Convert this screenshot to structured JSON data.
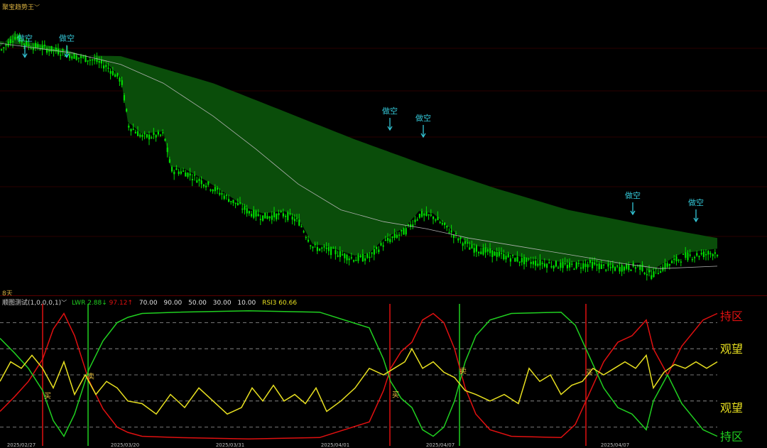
{
  "header": {
    "indicator_name": "聚宝趋势王",
    "dropdown_icon": "chevron-down-icon"
  },
  "lower_header": {
    "indicator_name": "顺图测试(1,0,0,0,1)",
    "lwr_label": "LWR",
    "lwr_value": "2.88",
    "lwr_arrow": "↓",
    "lwr_value2": "97.12",
    "lwr_arrow2": "↑",
    "levels": [
      "70.00",
      "90.00",
      "50.00",
      "30.00",
      "10.00"
    ],
    "rsi_label": "RSI3",
    "rsi_value": "60.66"
  },
  "divider_label": "8天",
  "colors": {
    "background": "#000000",
    "up_candle": "#00e000",
    "band_fill": "#0a4d0a",
    "ma_line": "#b0b0b0",
    "signal_text": "#33c6d6",
    "buy_text": "#e8c040",
    "red_line": "#e01010",
    "green_line": "#20d020",
    "yellow_line": "#e8e020",
    "hold_label": "#e01010",
    "watch_label": "#e8e020",
    "hold2_label": "#20d020",
    "dashed": "#9a9a9a",
    "frame": "#5a0000"
  },
  "chart_data": [
    {
      "type": "candlestick",
      "title": "聚宝趋势王",
      "x_dates": [
        "2025/02/27",
        "2025/03/20",
        "2025/03/31",
        "2025/04/01",
        "2025/04/07",
        "2025/04/07"
      ],
      "price_path": [
        [
          0,
          30
        ],
        [
          20,
          30.6
        ],
        [
          40,
          30.2
        ],
        [
          60,
          30.1
        ],
        [
          90,
          29.9
        ],
        [
          110,
          29.7
        ],
        [
          130,
          29.6
        ],
        [
          150,
          29.3
        ],
        [
          170,
          28.7
        ],
        [
          180,
          26.8
        ],
        [
          200,
          26.3
        ],
        [
          230,
          26.4
        ],
        [
          240,
          24.9
        ],
        [
          260,
          24.8
        ],
        [
          290,
          24.3
        ],
        [
          320,
          23.7
        ],
        [
          350,
          23.1
        ],
        [
          370,
          22.9
        ],
        [
          400,
          23.0
        ],
        [
          420,
          22.7
        ],
        [
          440,
          21.6
        ],
        [
          460,
          21.5
        ],
        [
          500,
          21.1
        ],
        [
          520,
          21.2
        ],
        [
          540,
          21.8
        ],
        [
          570,
          22.3
        ],
        [
          590,
          23.0
        ],
        [
          610,
          22.9
        ],
        [
          640,
          22.1
        ],
        [
          660,
          21.6
        ],
        [
          700,
          21.3
        ],
        [
          740,
          21.0
        ],
        [
          770,
          20.9
        ],
        [
          800,
          20.8
        ],
        [
          830,
          20.9
        ],
        [
          860,
          20.7
        ],
        [
          900,
          20.8
        ],
        [
          915,
          20.4
        ],
        [
          930,
          20.7
        ],
        [
          960,
          21.2
        ],
        [
          1010,
          21.4
        ]
      ],
      "ma_path": [
        [
          0,
          30.3
        ],
        [
          100,
          29.9
        ],
        [
          170,
          29.4
        ],
        [
          230,
          28.6
        ],
        [
          300,
          27.2
        ],
        [
          360,
          25.8
        ],
        [
          420,
          24.3
        ],
        [
          480,
          23.2
        ],
        [
          540,
          22.7
        ],
        [
          600,
          22.4
        ],
        [
          660,
          22.0
        ],
        [
          720,
          21.7
        ],
        [
          800,
          21.3
        ],
        [
          880,
          20.9
        ],
        [
          930,
          20.7
        ],
        [
          1010,
          20.8
        ]
      ],
      "band_top_path": [
        [
          0,
          30.4
        ],
        [
          100,
          29.8
        ],
        [
          170,
          29.75
        ],
        [
          300,
          28.6
        ],
        [
          400,
          27.4
        ],
        [
          500,
          26.2
        ],
        [
          600,
          25.1
        ],
        [
          700,
          24.1
        ],
        [
          800,
          23.2
        ],
        [
          900,
          22.6
        ],
        [
          1010,
          22.0
        ]
      ],
      "ylim": [
        19.8,
        31.6
      ],
      "signals": [
        {
          "x": 35,
          "y": 30.1,
          "label": "做空"
        },
        {
          "x": 94,
          "y": 30.1,
          "label": "做空"
        },
        {
          "x": 549,
          "y": 27.0,
          "label": "做空"
        },
        {
          "x": 596,
          "y": 26.7,
          "label": "做空"
        },
        {
          "x": 891,
          "y": 23.4,
          "label": "做空"
        },
        {
          "x": 980,
          "y": 23.1,
          "label": "做空"
        }
      ]
    },
    {
      "type": "line",
      "title": "顺图测试(1,0,0,0,1)",
      "ylim": [
        0,
        100
      ],
      "levels": [
        90,
        70,
        50,
        30,
        10
      ],
      "series": [
        {
          "name": "LWR",
          "color": "#e01010",
          "points": [
            [
              0,
              22
            ],
            [
              20,
              33
            ],
            [
              40,
              45
            ],
            [
              60,
              62
            ],
            [
              75,
              85
            ],
            [
              90,
              97
            ],
            [
              105,
              80
            ],
            [
              125,
              46
            ],
            [
              145,
              24
            ],
            [
              165,
              10
            ],
            [
              180,
              6
            ],
            [
              200,
              3
            ],
            [
              250,
              2
            ],
            [
              350,
              1
            ],
            [
              450,
              2
            ],
            [
              520,
              14
            ],
            [
              540,
              38
            ],
            [
              550,
              55
            ],
            [
              565,
              68
            ],
            [
              580,
              75
            ],
            [
              595,
              92
            ],
            [
              610,
              97
            ],
            [
              625,
              90
            ],
            [
              640,
              70
            ],
            [
              655,
              40
            ],
            [
              670,
              20
            ],
            [
              690,
              8
            ],
            [
              720,
              3
            ],
            [
              790,
              2
            ],
            [
              810,
              12
            ],
            [
              825,
              30
            ],
            [
              850,
              60
            ],
            [
              870,
              75
            ],
            [
              890,
              80
            ],
            [
              910,
              92
            ],
            [
              920,
              70
            ],
            [
              940,
              50
            ],
            [
              960,
              72
            ],
            [
              990,
              92
            ],
            [
              1010,
              97
            ]
          ]
        },
        {
          "name": "LWR2",
          "color": "#20d020",
          "points": [
            [
              0,
              78
            ],
            [
              20,
              67
            ],
            [
              40,
              55
            ],
            [
              60,
              38
            ],
            [
              75,
              15
            ],
            [
              90,
              3
            ],
            [
              105,
              20
            ],
            [
              125,
              54
            ],
            [
              145,
              76
            ],
            [
              165,
              90
            ],
            [
              180,
              94
            ],
            [
              200,
              97
            ],
            [
              250,
              98
            ],
            [
              350,
              99
            ],
            [
              450,
              98
            ],
            [
              520,
              86
            ],
            [
              540,
              62
            ],
            [
              550,
              45
            ],
            [
              565,
              32
            ],
            [
              580,
              25
            ],
            [
              595,
              8
            ],
            [
              610,
              3
            ],
            [
              625,
              10
            ],
            [
              640,
              30
            ],
            [
              655,
              60
            ],
            [
              670,
              80
            ],
            [
              690,
              92
            ],
            [
              720,
              97
            ],
            [
              790,
              98
            ],
            [
              810,
              88
            ],
            [
              825,
              70
            ],
            [
              850,
              40
            ],
            [
              870,
              25
            ],
            [
              890,
              20
            ],
            [
              910,
              8
            ],
            [
              920,
              30
            ],
            [
              940,
              50
            ],
            [
              960,
              28
            ],
            [
              990,
              8
            ],
            [
              1010,
              3
            ]
          ]
        },
        {
          "name": "RSI3",
          "color": "#e8e020",
          "points": [
            [
              0,
              45
            ],
            [
              15,
              60
            ],
            [
              30,
              55
            ],
            [
              45,
              65
            ],
            [
              60,
              55
            ],
            [
              75,
              40
            ],
            [
              90,
              60
            ],
            [
              105,
              35
            ],
            [
              120,
              50
            ],
            [
              135,
              35
            ],
            [
              150,
              45
            ],
            [
              165,
              40
            ],
            [
              180,
              30
            ],
            [
              200,
              28
            ],
            [
              220,
              20
            ],
            [
              240,
              35
            ],
            [
              260,
              25
            ],
            [
              280,
              40
            ],
            [
              300,
              30
            ],
            [
              320,
              20
            ],
            [
              340,
              25
            ],
            [
              355,
              40
            ],
            [
              370,
              30
            ],
            [
              385,
              42
            ],
            [
              400,
              30
            ],
            [
              415,
              35
            ],
            [
              430,
              28
            ],
            [
              445,
              40
            ],
            [
              460,
              22
            ],
            [
              480,
              30
            ],
            [
              500,
              40
            ],
            [
              520,
              55
            ],
            [
              540,
              50
            ],
            [
              555,
              55
            ],
            [
              570,
              60
            ],
            [
              580,
              70
            ],
            [
              595,
              55
            ],
            [
              610,
              60
            ],
            [
              625,
              52
            ],
            [
              640,
              48
            ],
            [
              655,
              38
            ],
            [
              670,
              35
            ],
            [
              690,
              30
            ],
            [
              710,
              35
            ],
            [
              730,
              28
            ],
            [
              745,
              55
            ],
            [
              760,
              45
            ],
            [
              775,
              50
            ],
            [
              790,
              35
            ],
            [
              805,
              42
            ],
            [
              820,
              45
            ],
            [
              835,
              55
            ],
            [
              850,
              50
            ],
            [
              865,
              55
            ],
            [
              880,
              60
            ],
            [
              895,
              55
            ],
            [
              910,
              65
            ],
            [
              920,
              40
            ],
            [
              935,
              52
            ],
            [
              950,
              58
            ],
            [
              965,
              55
            ],
            [
              980,
              60
            ],
            [
              995,
              55
            ],
            [
              1010,
              60
            ]
          ]
        }
      ],
      "red_verticals": [
        60,
        549,
        825
      ],
      "green_verticals": [
        124,
        647
      ],
      "trade_marks": [
        {
          "x": 67,
          "y": 32,
          "label": "买"
        },
        {
          "x": 128,
          "y": 47,
          "label": "卖"
        },
        {
          "x": 557,
          "y": 33,
          "label": "买"
        },
        {
          "x": 652,
          "y": 51,
          "label": "卖"
        },
        {
          "x": 830,
          "y": 50,
          "label": "买"
        }
      ],
      "zone_labels": [
        {
          "label": "持区",
          "color_key": "hold_label",
          "level": 95
        },
        {
          "label": "观望",
          "color_key": "watch_label",
          "level": 70
        },
        {
          "label": "观望",
          "color_key": "watch_label",
          "level": 25
        },
        {
          "label": "持区",
          "color_key": "hold2_label",
          "level": 3
        }
      ]
    }
  ]
}
